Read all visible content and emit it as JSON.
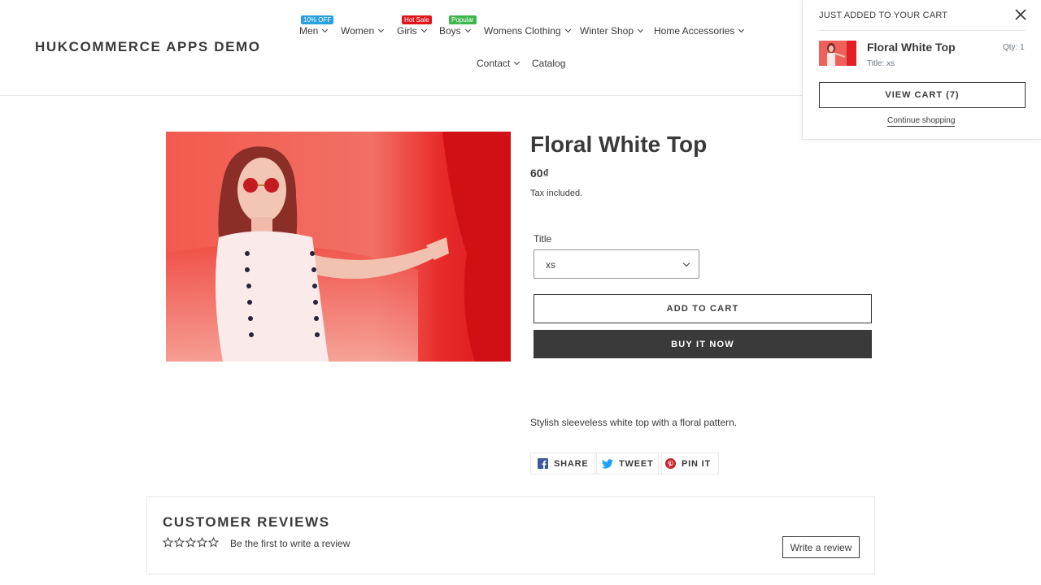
{
  "header": {
    "logo": "HUKCOMMERCE APPS DEMO",
    "nav": [
      {
        "label": "Men",
        "badge": "10% OFF",
        "badge_color": "#2a9fe0"
      },
      {
        "label": "Women"
      },
      {
        "label": "Girls",
        "badge": "Hot Sale",
        "badge_color": "#e0161c"
      },
      {
        "label": "Boys",
        "badge": "Popular",
        "badge_color": "#3cb64a"
      },
      {
        "label": "Womens Clothing"
      },
      {
        "label": "Winter Shop"
      },
      {
        "label": "Home Accessories"
      },
      {
        "label": "Contact"
      },
      {
        "label": "Catalog"
      }
    ]
  },
  "cart_popup": {
    "heading": "JUST ADDED TO YOUR CART",
    "product_title": "Floral White Top",
    "variant": "Title: xs",
    "qty": "Qty: 1",
    "view_cart": "VIEW CART (7)",
    "continue": "Continue shopping"
  },
  "product": {
    "title": "Floral White Top",
    "price": "60₫",
    "tax_note": "Tax included.",
    "variant_label": "Title",
    "variant_value": "xs",
    "add_to_cart": "ADD TO CART",
    "buy_now": "BUY IT NOW",
    "description": "Stylish sleeveless white top with a floral pattern."
  },
  "share": {
    "facebook": "SHARE",
    "twitter": "TWEET",
    "pinterest": "PIN IT"
  },
  "reviews": {
    "title": "CUSTOMER REVIEWS",
    "rating": 0,
    "cta": "Be the first to write a review",
    "write_button": "Write a review"
  },
  "colors": {
    "text": "#3a3a3a",
    "button_dark": "#3a3a3a",
    "product_bg": "#ec2a2a",
    "facebook": "#3b5998",
    "twitter": "#1da1f2",
    "pinterest": "#c8232c"
  }
}
